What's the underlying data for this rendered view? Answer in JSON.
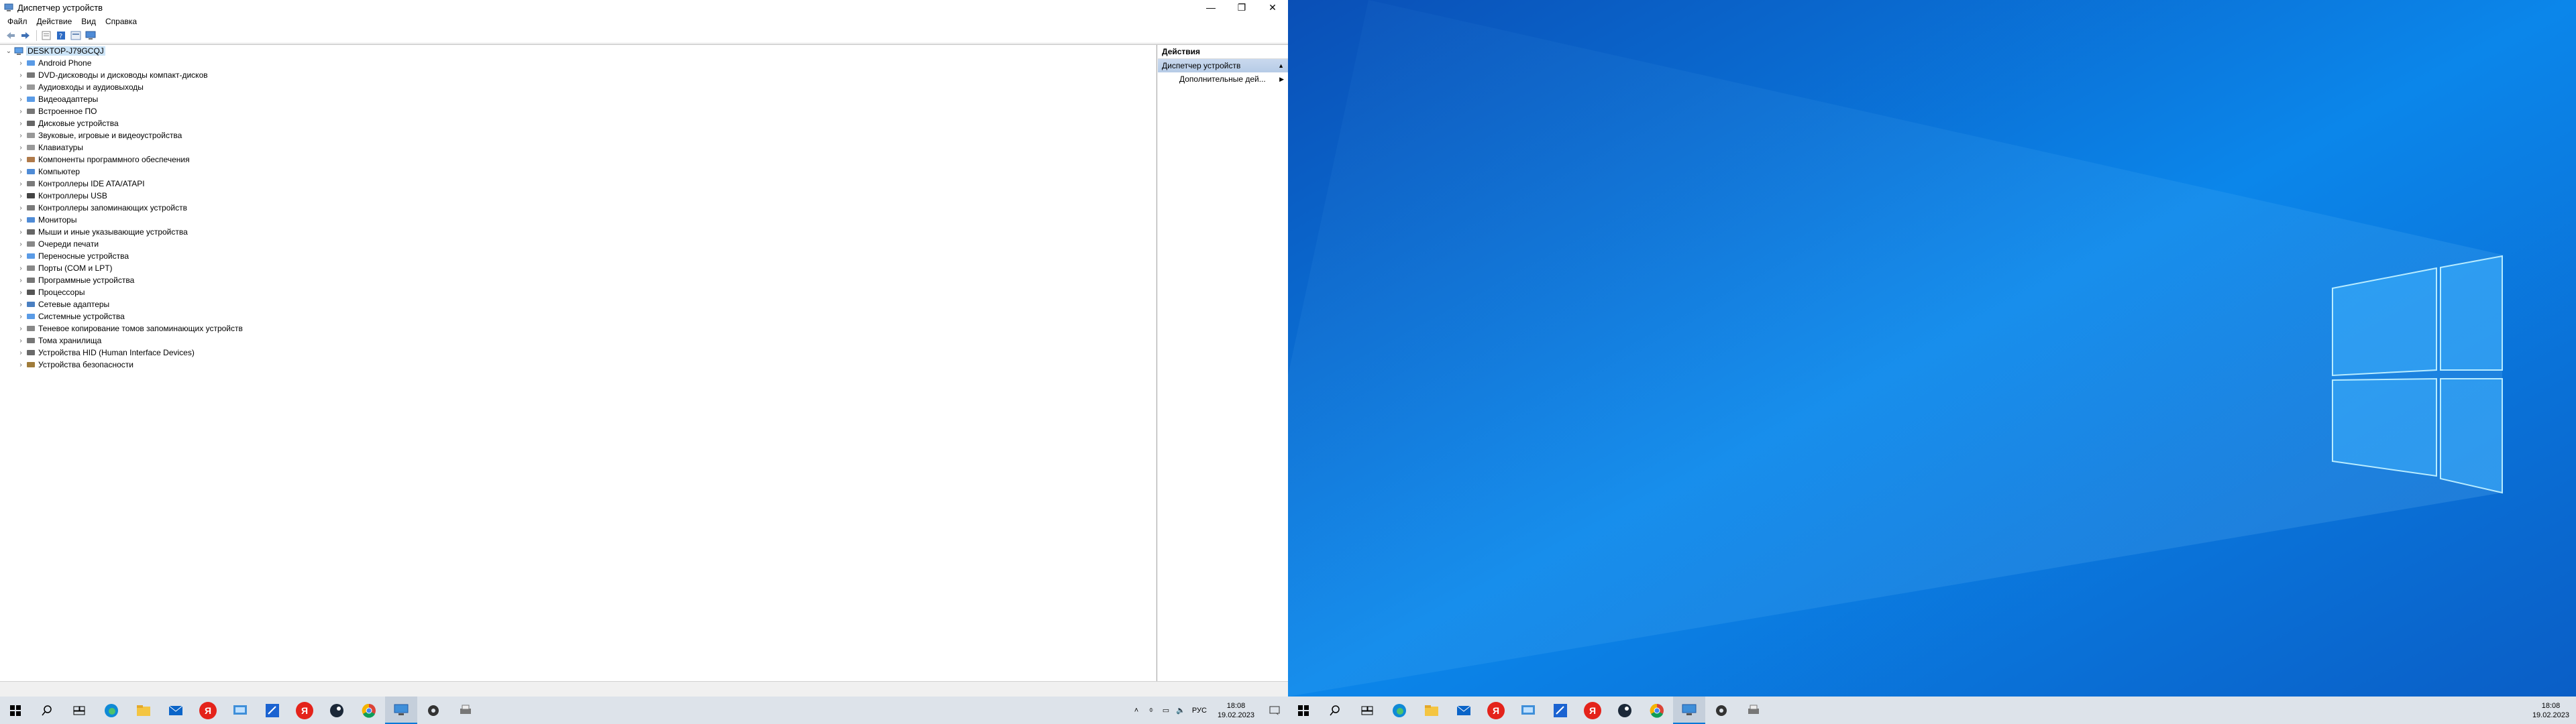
{
  "window": {
    "title": "Диспетчер устройств",
    "controls": {
      "minimize": "—",
      "restore": "❐",
      "close": "✕"
    }
  },
  "menu": [
    "Файл",
    "Действие",
    "Вид",
    "Справка"
  ],
  "tree": {
    "root": "DESKTOP-J79GCQJ",
    "items": [
      "Android Phone",
      "DVD-дисководы и дисководы компакт-дисков",
      "Аудиовходы и аудиовыходы",
      "Видеоадаптеры",
      "Встроенное ПО",
      "Дисковые устройства",
      "Звуковые, игровые и видеоустройства",
      "Клавиатуры",
      "Компоненты программного обеспечения",
      "Компьютер",
      "Контроллеры IDE ATA/ATAPI",
      "Контроллеры USB",
      "Контроллеры запоминающих устройств",
      "Мониторы",
      "Мыши и иные указывающие устройства",
      "Очереди печати",
      "Переносные устройства",
      "Порты (COM и LPT)",
      "Программные устройства",
      "Процессоры",
      "Сетевые адаптеры",
      "Системные устройства",
      "Теневое копирование томов запоминающих устройств",
      "Тома хранилища",
      "Устройства HID (Human Interface Devices)",
      "Устройства безопасности"
    ]
  },
  "actions": {
    "header": "Действия",
    "section": "Диспетчер устройств",
    "item": "Дополнительные дей..."
  },
  "tray": {
    "lang": "РУС",
    "time": "18:08",
    "date": "19.02.2023"
  },
  "taskbar_icons": [
    "windows-start-icon",
    "search-icon",
    "task-view-icon",
    "edge-icon",
    "file-explorer-icon",
    "mail-icon",
    "yandex-browser-icon",
    "screen-icon",
    "vscode-like-icon",
    "yandex-browser-icon",
    "steam-icon",
    "chrome-icon",
    "device-manager-icon",
    "settings-icon",
    "printer-icon"
  ]
}
